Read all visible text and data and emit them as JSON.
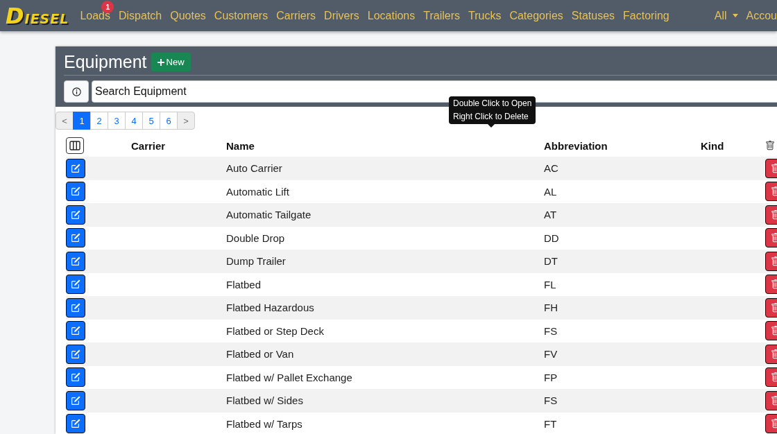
{
  "navbar": {
    "logo": "DIESEL",
    "items": [
      {
        "label": "Loads",
        "badge": "1"
      },
      {
        "label": "Dispatch"
      },
      {
        "label": "Quotes"
      },
      {
        "label": "Customers"
      },
      {
        "label": "Carriers"
      },
      {
        "label": "Drivers"
      },
      {
        "label": "Locations"
      },
      {
        "label": "Trailers"
      },
      {
        "label": "Trucks"
      },
      {
        "label": "Categories"
      },
      {
        "label": "Statuses"
      },
      {
        "label": "Factoring"
      }
    ],
    "filter": "All",
    "account": "Accou"
  },
  "page": {
    "title": "Equipment",
    "new_button": "New",
    "search": {
      "placeholder": "Search Equipment"
    },
    "pagination": [
      {
        "label": "<",
        "selected": false
      },
      {
        "label": "1",
        "selected": true
      },
      {
        "label": "2",
        "selected": false
      },
      {
        "label": "3",
        "selected": false
      },
      {
        "label": "4",
        "selected": false
      },
      {
        "label": "5",
        "selected": false
      },
      {
        "label": "6",
        "selected": false
      },
      {
        "label": ">",
        "selected": false
      }
    ],
    "tooltip": [
      "Double Click to Open",
      "Right Click to Delete"
    ],
    "table": {
      "columns": [
        "Carrier",
        "Name",
        "Abbreviation",
        "Kind"
      ],
      "rows": [
        {
          "name": "Auto Carrier",
          "abbreviation": "AC"
        },
        {
          "name": "Automatic Lift",
          "abbreviation": "AL"
        },
        {
          "name": "Automatic Tailgate",
          "abbreviation": "AT"
        },
        {
          "name": "Double Drop",
          "abbreviation": "DD"
        },
        {
          "name": "Dump Trailer",
          "abbreviation": "DT"
        },
        {
          "name": "Flatbed",
          "abbreviation": "FL"
        },
        {
          "name": "Flatbed Hazardous",
          "abbreviation": "FH"
        },
        {
          "name": "Flatbed or Step Deck",
          "abbreviation": "FS"
        },
        {
          "name": "Flatbed or Van",
          "abbreviation": "FV"
        },
        {
          "name": "Flatbed w/ Pallet Exchange",
          "abbreviation": "FP"
        },
        {
          "name": "Flatbed w/ Sides",
          "abbreviation": "FS"
        },
        {
          "name": "Flatbed w/ Tarps",
          "abbreviation": "FT"
        }
      ]
    }
  }
}
